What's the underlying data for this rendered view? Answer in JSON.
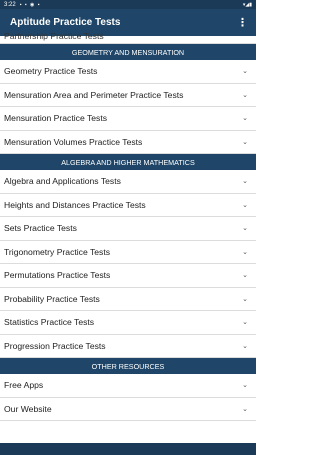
{
  "status_bar": {
    "time": "3:22",
    "icons": "▪ ▪ ◉ ▪",
    "right": "▾◢▮"
  },
  "app_bar": {
    "title": "Aptitude Practice Tests",
    "menu_icon": "⋮"
  },
  "partial_item": {
    "label": "Partnership Practice Tests"
  },
  "sections": [
    {
      "header": "GEOMETRY AND MENSURATION",
      "items": [
        {
          "label": "Geometry Practice Tests"
        },
        {
          "label": "Mensuration Area and Perimeter Practice Tests"
        },
        {
          "label": "Mensuration Practice Tests"
        },
        {
          "label": "Mensuration Volumes Practice Tests"
        }
      ]
    },
    {
      "header": "ALGEBRA AND HIGHER MATHEMATICS",
      "items": [
        {
          "label": "Algebra and Applications Tests"
        },
        {
          "label": "Heights and Distances Practice Tests"
        },
        {
          "label": "Sets Practice Tests"
        },
        {
          "label": "Trigonometry Practice Tests"
        },
        {
          "label": "Permutations Practice Tests"
        },
        {
          "label": "Probability Practice Tests"
        },
        {
          "label": "Statistics Practice Tests"
        },
        {
          "label": "Progression Practice Tests"
        }
      ]
    },
    {
      "header": "OTHER RESOURCES",
      "items": [
        {
          "label": "Free Apps"
        },
        {
          "label": "Our Website"
        }
      ]
    }
  ],
  "chevron_icon": "⌄",
  "colors": {
    "primary": "#1f4668",
    "status_bar": "#1b3a57"
  }
}
